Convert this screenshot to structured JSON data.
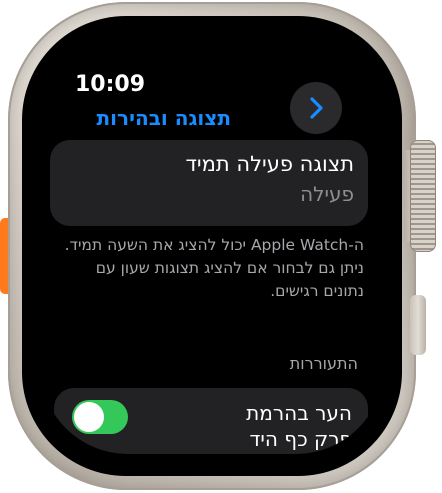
{
  "status": {
    "time": "10:09"
  },
  "nav": {
    "title": "תצוגה ובהירות",
    "back_icon": "chevron-right-icon"
  },
  "always_on": {
    "label": "תצוגה פעילה תמיד",
    "value": "פעילה"
  },
  "description": "ה-Apple Watch יכול להציג את השעה תמיד. ניתן גם לבחור אם להציג תצוגות שעון עם נתונים רגישים.",
  "wake_section": {
    "header": "התעוררות",
    "raise_to_wake": {
      "label": "הער בהרמת",
      "label_cont": "פרק כף היד",
      "enabled": true
    }
  },
  "colors": {
    "accent": "#1a8cff",
    "toggle_on": "#34c759",
    "action_button": "#ff7a1a"
  }
}
